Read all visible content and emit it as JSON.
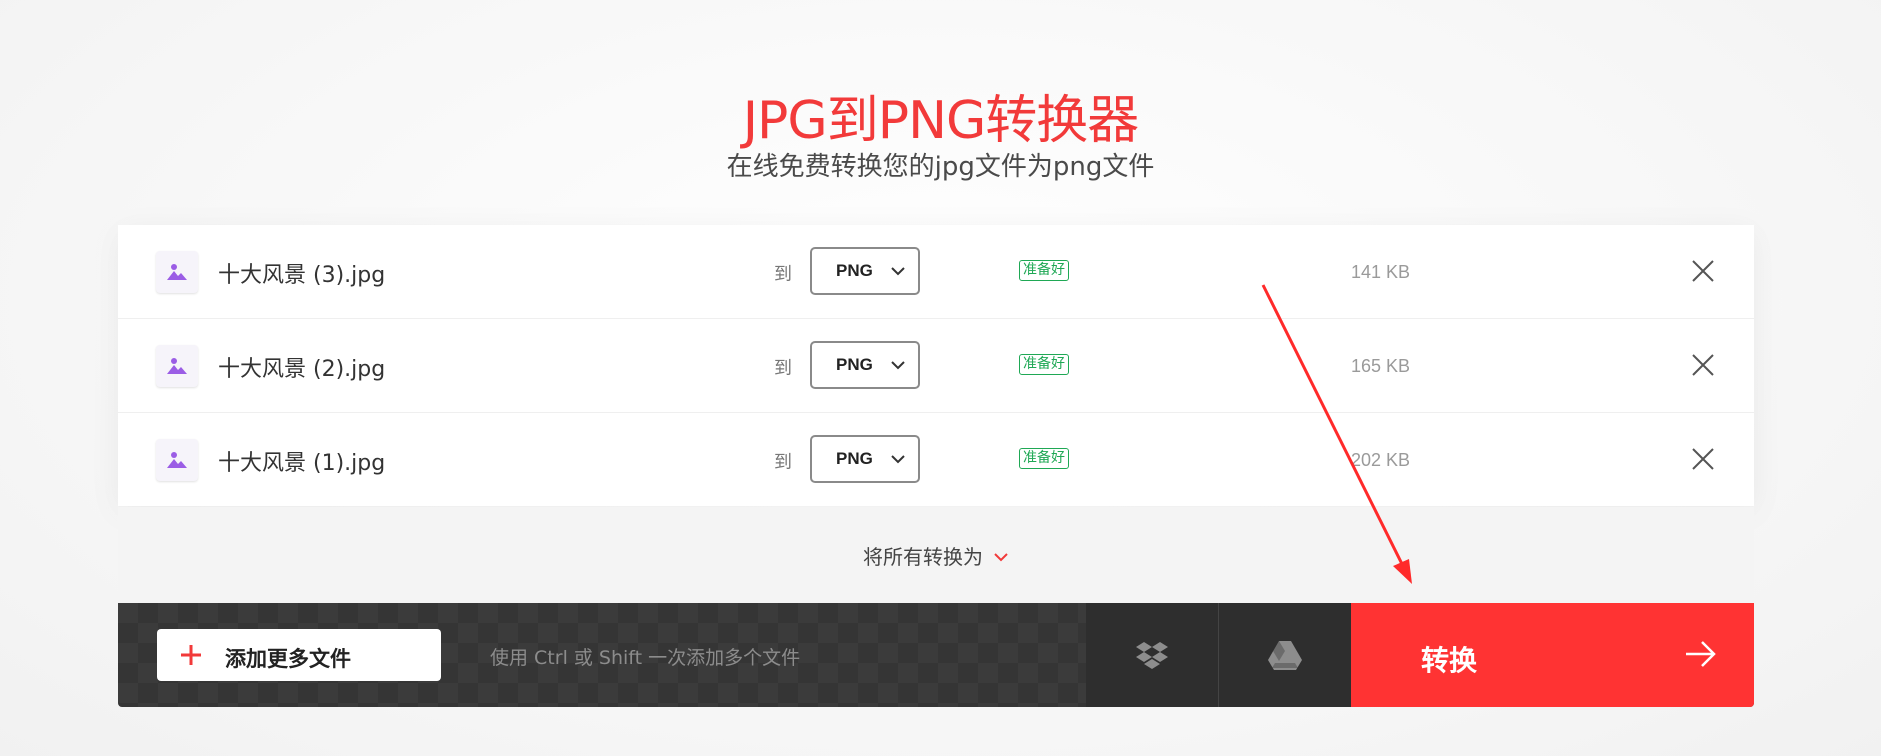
{
  "header": {
    "title": "JPG到PNG转换器",
    "subtitle": "在线免费转换您的jpg文件为png文件"
  },
  "files": [
    {
      "name": "十大风景 (3).jpg",
      "to_label": "到",
      "format": "PNG",
      "status": "准备好",
      "size": "141 KB"
    },
    {
      "name": "十大风景 (2).jpg",
      "to_label": "到",
      "format": "PNG",
      "status": "准备好",
      "size": "165 KB"
    },
    {
      "name": "十大风景 (1).jpg",
      "to_label": "到",
      "format": "PNG",
      "status": "准备好",
      "size": "202 KB"
    }
  ],
  "convert_all": {
    "label": "将所有转换为"
  },
  "bottom_bar": {
    "add_files_label": "添加更多文件",
    "hint": "使用 Ctrl 或 Shift 一次添加多个文件",
    "convert_label": "转换"
  },
  "colors": {
    "accent": "#ff3333",
    "title": "#f23a3a",
    "ready": "#1fa855",
    "bar": "#3b3b3b"
  },
  "icons": [
    "image-icon",
    "chevron-down-icon",
    "close-icon",
    "plus-icon",
    "dropbox-icon",
    "google-drive-icon",
    "arrow-right-icon"
  ]
}
